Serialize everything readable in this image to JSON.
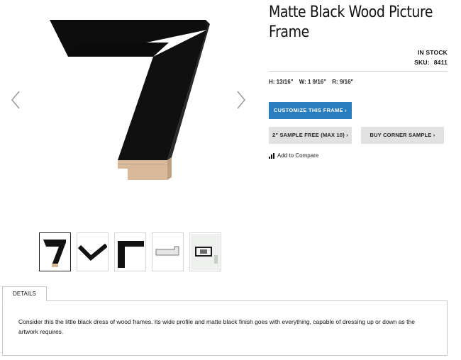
{
  "product": {
    "title": "Matte Black Wood Picture Frame",
    "stock_status": "IN STOCK",
    "sku_label": "SKU:",
    "sku_value": "8411",
    "dimensions": {
      "height": "H: 13/16\"",
      "width": "W: 1 9/16\"",
      "rabbet": "R: 9/16\""
    }
  },
  "actions": {
    "customize_label": "CUSTOMIZE THIS FRAME ›",
    "sample_label": "2\" SAMPLE FREE (MAX 10) ›",
    "corner_sample_label": "BUY CORNER SAMPLE ›",
    "compare_label": "Add to Compare"
  },
  "gallery": {
    "thumbnails": [
      {
        "name": "frame-corner-front",
        "active": true
      },
      {
        "name": "frame-chevron",
        "active": false
      },
      {
        "name": "frame-corner-flat",
        "active": false
      },
      {
        "name": "frame-profile",
        "active": false
      },
      {
        "name": "framed-art-room",
        "active": false
      }
    ]
  },
  "tabs": [
    {
      "label": "DETAILS",
      "active": true
    }
  ],
  "details": {
    "text": "Consider this the little black dress of wood frames. Its wide profile and matte black finish goes with everything, capable of dressing up or down as the artwork requires."
  },
  "colors": {
    "primary_button": "#2a7ebf",
    "secondary_button": "#e1e1e1",
    "frame_black": "#0d0d0d",
    "wood_edge": "#d8b99a"
  },
  "icons": {
    "prev": "chevron-left-icon",
    "next": "chevron-right-icon",
    "compare": "bar-chart-icon"
  }
}
